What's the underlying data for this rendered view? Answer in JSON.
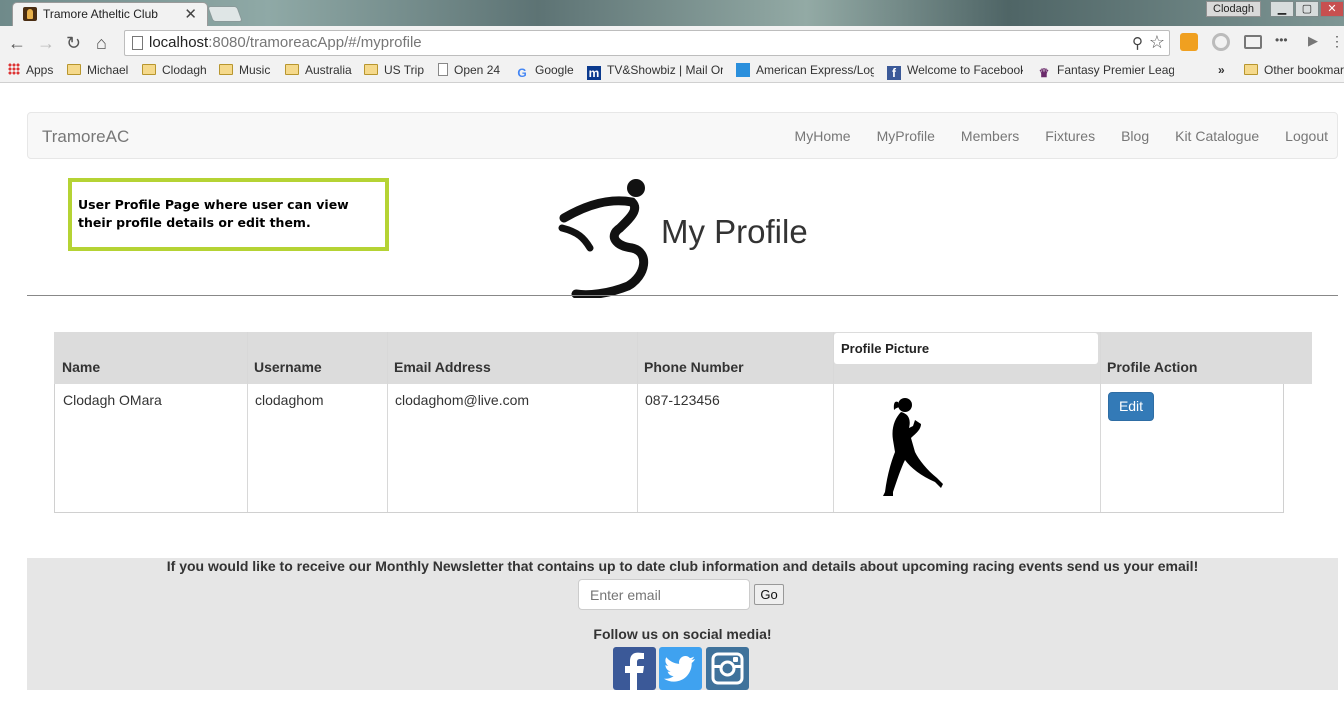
{
  "browser": {
    "tab_title": "Tramore Atheltic Club",
    "tab_close": "✕",
    "profile_name": "Clodagh",
    "url_host": "localhost",
    "url_rest": ":8080/tramoreacApp/#/myprofile",
    "bookmarks": [
      {
        "label": "Apps",
        "type": "apps"
      },
      {
        "label": "Michael",
        "type": "folder"
      },
      {
        "label": "Clodagh",
        "type": "folder"
      },
      {
        "label": "Music",
        "type": "folder"
      },
      {
        "label": "Australia",
        "type": "folder"
      },
      {
        "label": "US Trip",
        "type": "folder"
      },
      {
        "label": "Open 24",
        "type": "page"
      },
      {
        "label": "Google",
        "type": "google"
      },
      {
        "label": "TV&Showbiz | Mail Or",
        "type": "mail"
      },
      {
        "label": "American Express/Log",
        "type": "amex"
      },
      {
        "label": "Welcome to Facebook",
        "type": "facebook"
      },
      {
        "label": "Fantasy Premier Leag",
        "type": "fpl"
      }
    ],
    "overflow": "»",
    "other_bookmarks": "Other bookmarks"
  },
  "nav": {
    "brand": "TramoreAC",
    "links": [
      "MyHome",
      "MyProfile",
      "Members",
      "Fixtures",
      "Blog",
      "Kit Catalogue",
      "Logout"
    ]
  },
  "annotation": "User Profile Page where user can view their profile details or edit them.",
  "page_title": "My Profile",
  "table": {
    "headers": {
      "name": "Name",
      "username": "Username",
      "email": "Email Address",
      "phone": "Phone Number",
      "picture": "Profile Picture",
      "action": "Profile Action"
    },
    "row": {
      "name": "Clodagh OMara",
      "username": "clodaghom",
      "email": "clodaghom@live.com",
      "phone": "087-123456",
      "action_button": "Edit"
    }
  },
  "footer": {
    "newsletter_text": "If you would like to receive our Monthly Newsletter that contains up to date club information and details about upcoming racing events send us your email!",
    "email_placeholder": "Enter email",
    "go_button": "Go",
    "follow_text": "Follow us on social media!",
    "social": [
      "facebook-icon",
      "twitter-icon",
      "instagram-icon"
    ]
  },
  "colors": {
    "annotation_border": "#b5d334",
    "edit_button": "#337ab7",
    "facebook": "#3b5998",
    "twitter": "#3fa2f0",
    "instagram": "#3f729b"
  }
}
